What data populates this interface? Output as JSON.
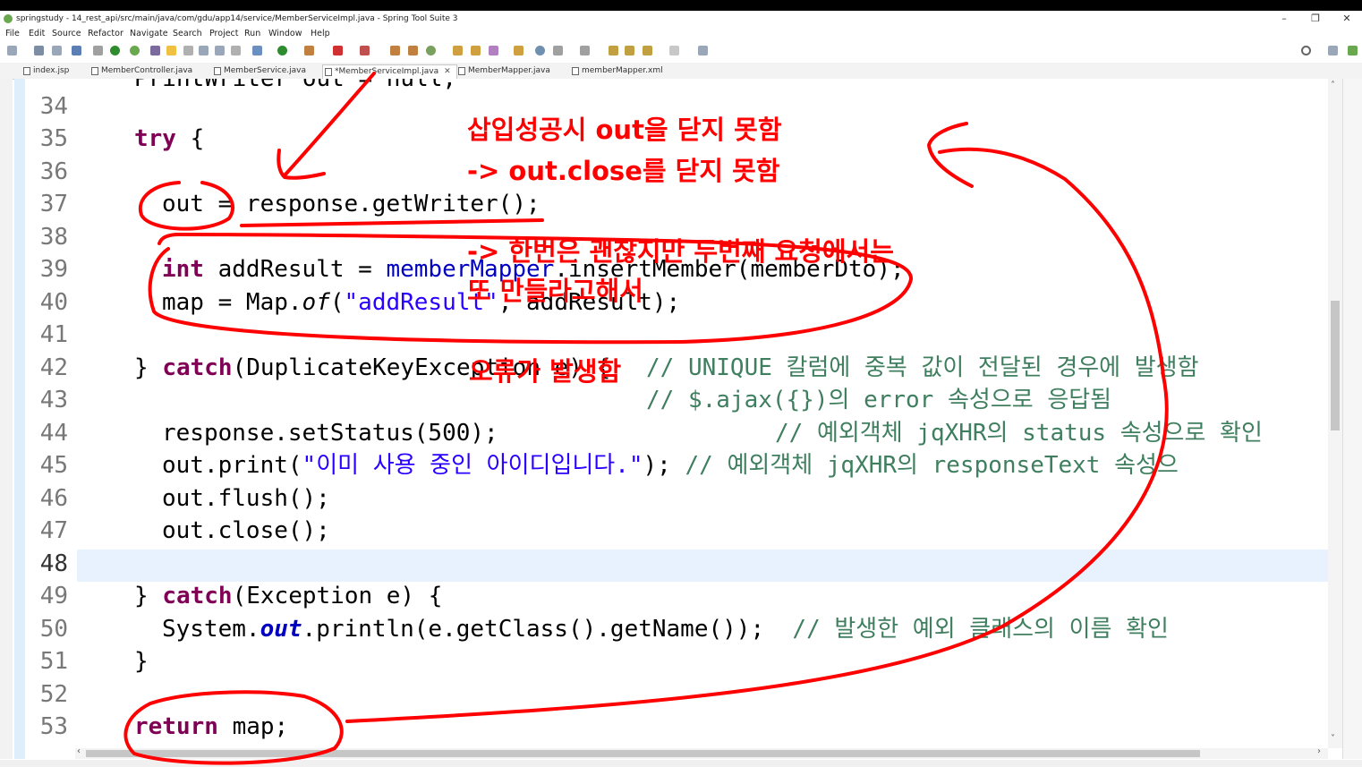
{
  "window": {
    "title": "springstudy - 14_rest_api/src/main/java/com/gdu/app14/service/MemberServiceImpl.java - Spring Tool Suite 3",
    "minimize": "–",
    "maximize": "❐",
    "close": "✕"
  },
  "menu": [
    "File",
    "Edit",
    "Source",
    "Refactor",
    "Navigate",
    "Search",
    "Project",
    "Run",
    "Window",
    "Help"
  ],
  "tabs": [
    {
      "label": "index.jsp",
      "active": false
    },
    {
      "label": "MemberController.java",
      "active": false
    },
    {
      "label": "MemberService.java",
      "active": false
    },
    {
      "label": "*MemberServiceImpl.java",
      "active": true,
      "close": "✕"
    },
    {
      "label": "MemberMapper.java",
      "active": false
    },
    {
      "label": "memberMapper.xml",
      "active": false
    }
  ],
  "editor": {
    "current_line": "48",
    "line_numbers": [
      "34",
      "35",
      "36",
      "37",
      "38",
      "39",
      "40",
      "41",
      "42",
      "43",
      "44",
      "45",
      "46",
      "47",
      "48",
      "49",
      "50",
      "51",
      "52",
      "53"
    ],
    "partial_top": "PrintWriter out = null;",
    "lines": {
      "l35_kw": "try",
      "l35_rest": " {",
      "l37": "out = response.getWriter();",
      "l39_kw": "int",
      "l39_a": " addResult = ",
      "l39_fld": "memberMapper",
      "l39_b": ".insertMember(memberDto);",
      "l40_a": "map = Map.",
      "l40_it": "of",
      "l40_b": "(",
      "l40_str": "\"addResult\"",
      "l40_c": ", addResult);",
      "l42_a": "} ",
      "l42_kw": "catch",
      "l42_b": "(DuplicateKeyException e) {",
      "l42_cmt": "// UNIQUE 칼럼에 중복 값이 전달된 경우에 발생함",
      "l43_cmt": "// $.ajax({})의 error 속성으로 응답됨",
      "l44": "response.setStatus(500);",
      "l44_cmt": "// 예외객체 jqXHR의 status 속성으로 확인",
      "l45_a": "out.print(",
      "l45_str": "\"이미 사용 중인 아이디입니다.\"",
      "l45_b": "); ",
      "l45_cmt": "// 예외객체 jqXHR의 responseText 속성으",
      "l46": "out.flush();",
      "l47": "out.close();",
      "l49_a": "} ",
      "l49_kw": "catch",
      "l49_b": "(Exception e) {",
      "l50_a": "System.",
      "l50_fld": "out",
      "l50_b": ".println(e.getClass().getName());  ",
      "l50_cmt": "// 발생한 예외 클래스의 이름 확인",
      "l51": "}",
      "l53_kw": "return",
      "l53_rest": " map;"
    }
  },
  "annotations": {
    "a1": "삽입성공시 out을 닫지 못함",
    "a2": "-> out.close를 닫지 못함",
    "a3": "-> 한번은 괜찮지만 두번째 요청에서는",
    "a4": "또 만들라고해서",
    "a5": "오류가 발생함"
  },
  "colors": {
    "keyword": "#7f0055",
    "field": "#0000c0",
    "string": "#2a00ff",
    "comment": "#3f7f5f",
    "annotation": "#ff0000",
    "current_line": "#e8f2fe"
  }
}
